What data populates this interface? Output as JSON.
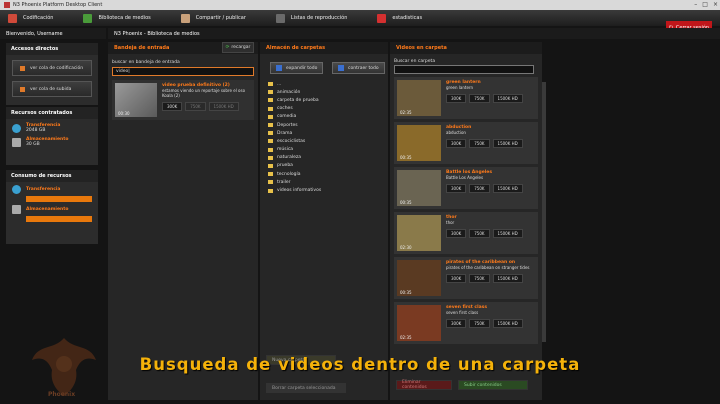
{
  "window": {
    "title": "N3 Phoenix Platform Desktop Client",
    "controls": [
      "–",
      "□",
      "×"
    ]
  },
  "menubar": {
    "items": [
      {
        "label": "Codificación",
        "icon": "film-icon",
        "color": "#d04a3a"
      },
      {
        "label": "Biblioteca de medios",
        "icon": "library-icon",
        "color": "#4a9b3a"
      },
      {
        "label": "Compartir / publicar",
        "icon": "share-icon",
        "color": "#c8a07a"
      },
      {
        "label": "Listas de reproducción",
        "icon": "playlist-icon",
        "color": "#6a6a6a"
      },
      {
        "label": "estadisticas",
        "icon": "stats-icon",
        "color": "#d43030"
      }
    ],
    "close_session": "Cerrar sesión"
  },
  "welcome": "Bienvenido, Username",
  "breadcrumb": "N3 Phoenix - Biblioteca de medios",
  "sidebar": {
    "quick": {
      "title": "Accesos directos",
      "buttons": [
        "ver cola de codificación",
        "ver cola de subida"
      ]
    },
    "resources": {
      "title": "Recursos contratados",
      "items": [
        {
          "label": "Transferencia",
          "value": "2048 GB"
        },
        {
          "label": "Almacenamiento",
          "value": "30 GB"
        }
      ]
    },
    "consumption": {
      "title": "Consumo de recursos",
      "items": [
        {
          "label": "Transferencia",
          "level": 1.0
        },
        {
          "label": "Almacenamiento",
          "level": 1.0
        }
      ]
    }
  },
  "inbox": {
    "title": "Bandeja de entrada",
    "reload": "recargar",
    "search_label": "buscar en bandeja de entrada",
    "search_value": "video|",
    "items": [
      {
        "title": "video prueba definitivo (2)",
        "desc": "estamos viendo un reportaje sobre el oso Koala (2)",
        "duration": "00:30",
        "qualities": [
          "300K",
          "750K",
          "1500K HD"
        ]
      }
    ]
  },
  "folders": {
    "title": "Almacén de carpetas",
    "expand": "expandir todo",
    "collapse": "contraer todo",
    "items": [
      "...",
      "animación",
      "carpeta de prueba",
      "coches",
      "comedia",
      "Deportes",
      "Drama",
      "escociclistas",
      "música",
      "naturaleza",
      "prueba",
      "tecnología",
      "trailer",
      "videos informativos"
    ],
    "bottom_buttons": [
      "Nueva carpeta",
      "Borrar carpeta seleccionada"
    ]
  },
  "videos": {
    "title": "Videos en carpeta",
    "search_label": "Buscar en carpeta",
    "items": [
      {
        "title": "green lantern",
        "desc": "green lantern",
        "duration": "02:35",
        "thumb": "#6b5a3a"
      },
      {
        "title": "abduction",
        "desc": "abduction",
        "duration": "00:35",
        "thumb": "#8a6a2a"
      },
      {
        "title": "Battle los Angeles",
        "desc": "Battle Los Angeles",
        "duration": "00:35",
        "thumb": "#6a6452"
      },
      {
        "title": "thor",
        "desc": "thor",
        "duration": "02:30",
        "thumb": "#8a7a4a"
      },
      {
        "title": "pirates of the caribbean on",
        "desc": "pirates of the caribbean on stranger tides",
        "duration": "00:35",
        "thumb": "#5a3a22"
      },
      {
        "title": "seven first class",
        "desc": "seven first class",
        "duration": "02:35",
        "thumb": "#7a3a22"
      }
    ],
    "qualities": [
      "300K",
      "750K",
      "1500K HD"
    ],
    "bottom_buttons": [
      "Eliminar contenidos",
      "Subir contenidos"
    ]
  },
  "caption": "Busqueda de videos dentro de una carpeta",
  "logo_text": "Phoenix"
}
